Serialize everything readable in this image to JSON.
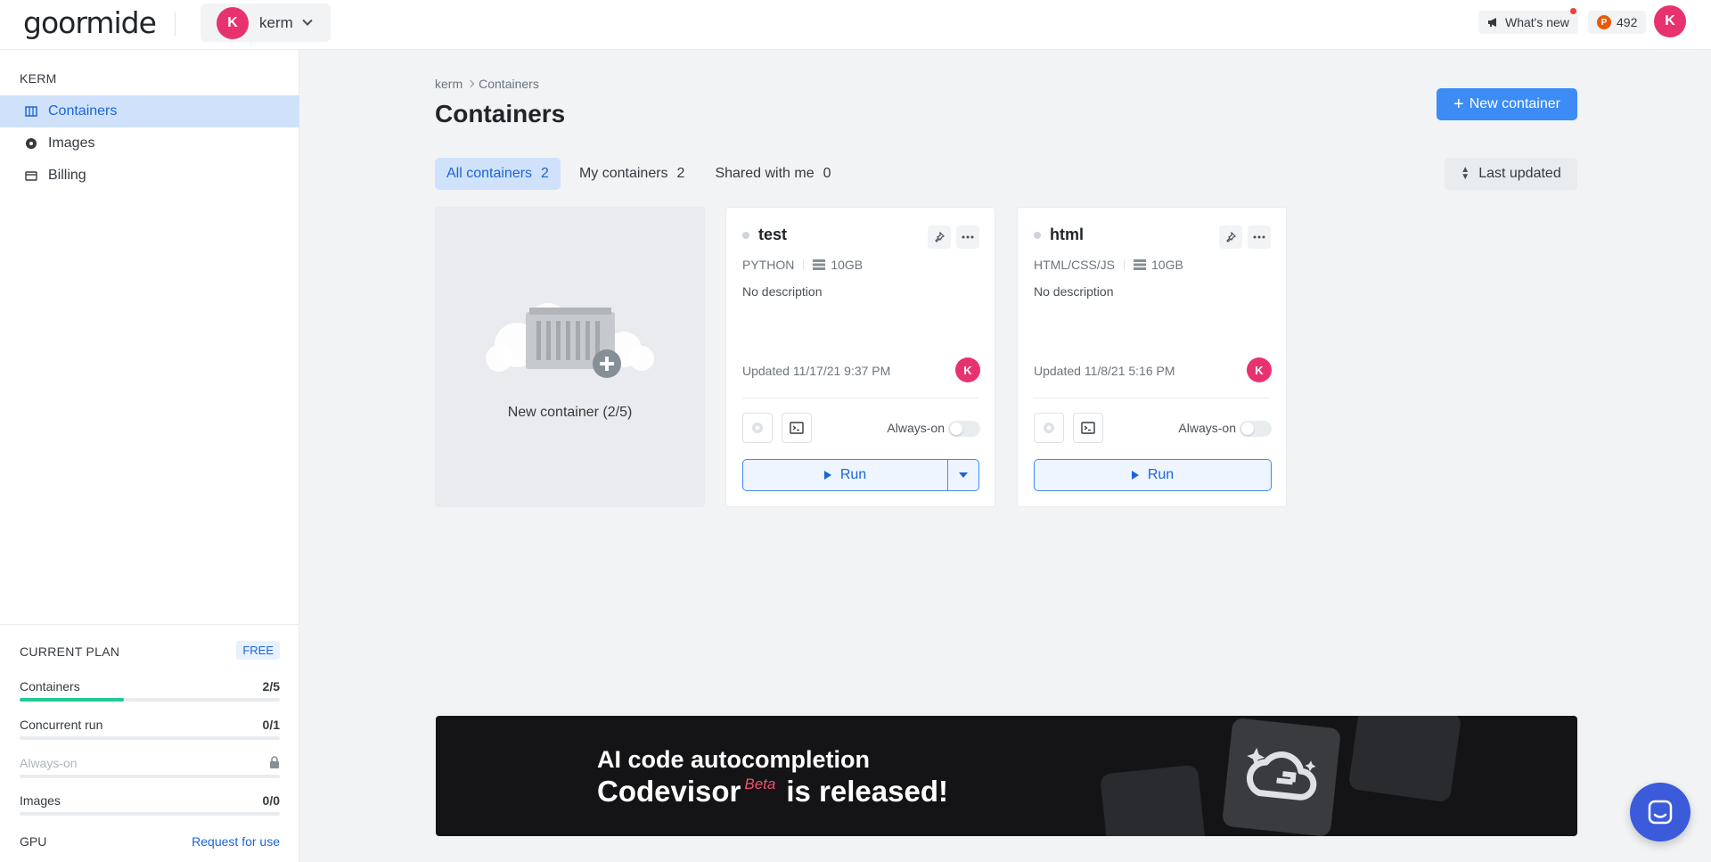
{
  "header": {
    "logo": "goormide",
    "org": {
      "avatar": "K",
      "name": "kerm"
    },
    "whats_new": "What's new",
    "points_badge": "P",
    "points": "492",
    "user_avatar": "K"
  },
  "sidebar": {
    "section": "KERM",
    "items": [
      {
        "label": "Containers",
        "icon": "containers-icon",
        "active": true
      },
      {
        "label": "Images",
        "icon": "disc-icon",
        "active": false
      },
      {
        "label": "Billing",
        "icon": "card-icon",
        "active": false
      }
    ],
    "plan": {
      "title": "CURRENT PLAN",
      "badge": "FREE",
      "rows": [
        {
          "label": "Containers",
          "value": "2/5",
          "progress": 0.4
        },
        {
          "label": "Concurrent run",
          "value": "0/1",
          "progress": 0
        },
        {
          "label": "Always-on",
          "locked": true
        },
        {
          "label": "Images",
          "value": "0/0",
          "progress": 0
        },
        {
          "label": "GPU",
          "link": "Request for use"
        }
      ]
    }
  },
  "main": {
    "breadcrumb": [
      "kerm",
      "Containers"
    ],
    "title": "Containers",
    "new_button": "New container",
    "tabs": [
      {
        "label": "All containers",
        "count": "2",
        "active": true
      },
      {
        "label": "My containers",
        "count": "2",
        "active": false
      },
      {
        "label": "Shared with me",
        "count": "0",
        "active": false
      }
    ],
    "sort": "Last updated",
    "new_card_label": "New container (2/5)",
    "containers": [
      {
        "name": "test",
        "stack": "PYTHON",
        "disk": "10GB",
        "description": "No description",
        "updated": "Updated 11/17/21 9:37 PM",
        "owner": "K",
        "always_on": "Always-on",
        "run": "Run",
        "has_dropdown": true
      },
      {
        "name": "html",
        "stack": "HTML/CSS/JS",
        "disk": "10GB",
        "description": "No description",
        "updated": "Updated 11/8/21 5:16 PM",
        "owner": "K",
        "always_on": "Always-on",
        "run": "Run",
        "has_dropdown": false
      }
    ]
  },
  "banner": {
    "line1": "AI code autocompletion",
    "line2_name": "Codevisor",
    "line2_beta": "Beta",
    "line2_rest": "is released!"
  },
  "colors": {
    "accent": "#3d8bf5",
    "avatar": "#e8316f",
    "active_bg": "#d0e2fb",
    "progress": "#20c997"
  }
}
